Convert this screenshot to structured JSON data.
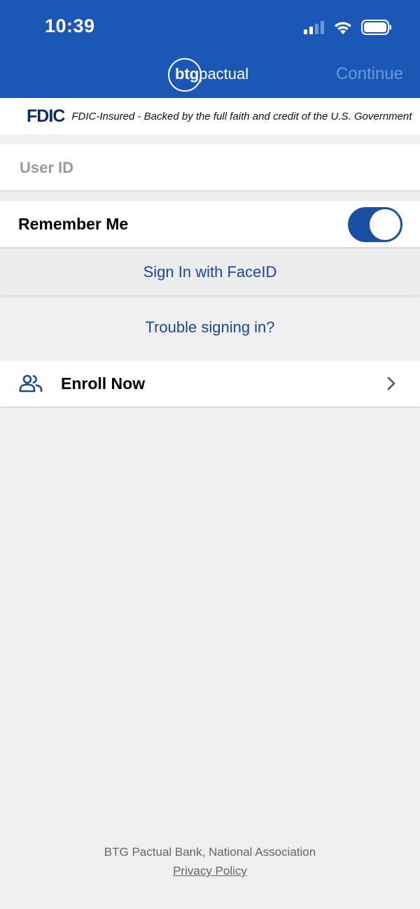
{
  "status_bar": {
    "time": "10:39"
  },
  "header": {
    "logo_btg": "btg",
    "logo_pactual": "pactual",
    "continue_label": "Continue"
  },
  "fdic": {
    "logo": "FDIC",
    "text": "FDIC-Insured - Backed by the full faith and credit of the U.S. Government"
  },
  "login": {
    "user_id_placeholder": "User ID",
    "user_id_value": "",
    "remember_me_label": "Remember Me",
    "remember_me_on": true,
    "faceid_label": "Sign In with FaceID",
    "trouble_label": "Trouble signing in?"
  },
  "enroll": {
    "label": "Enroll Now",
    "icon": "people-icon"
  },
  "footer": {
    "bank_name": "BTG Pactual Bank, National Association",
    "privacy_label": "Privacy Policy"
  },
  "colors": {
    "header_bg": "#1a57b6",
    "accent": "#1a4a91",
    "toggle_on": "#1a4fa3",
    "continue_disabled": "#6d9ad6",
    "background": "#efefef"
  }
}
